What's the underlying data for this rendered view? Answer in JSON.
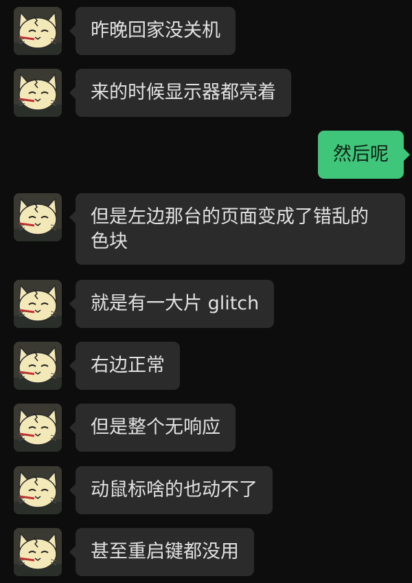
{
  "colors": {
    "background": "#0d0d0d",
    "received_bubble": "#2b2b2b",
    "received_text": "#e2e2e2",
    "sent_bubble": "#3fc67b",
    "sent_text": "#102015"
  },
  "contact": {
    "avatar_icon": "cat-avatar-icon"
  },
  "messages": [
    {
      "sender": "contact",
      "text": "昨晚回家没关机"
    },
    {
      "sender": "contact",
      "text": "来的时候显示器都亮着"
    },
    {
      "sender": "me",
      "text": "然后呢"
    },
    {
      "sender": "contact",
      "text": "但是左边那台的页面变成了错乱的\n色块"
    },
    {
      "sender": "contact",
      "text": "就是有一大片 glitch"
    },
    {
      "sender": "contact",
      "text": "右边正常"
    },
    {
      "sender": "contact",
      "text": "但是整个无响应"
    },
    {
      "sender": "contact",
      "text": "动鼠标啥的也动不了"
    },
    {
      "sender": "contact",
      "text": "甚至重启键都没用"
    }
  ]
}
